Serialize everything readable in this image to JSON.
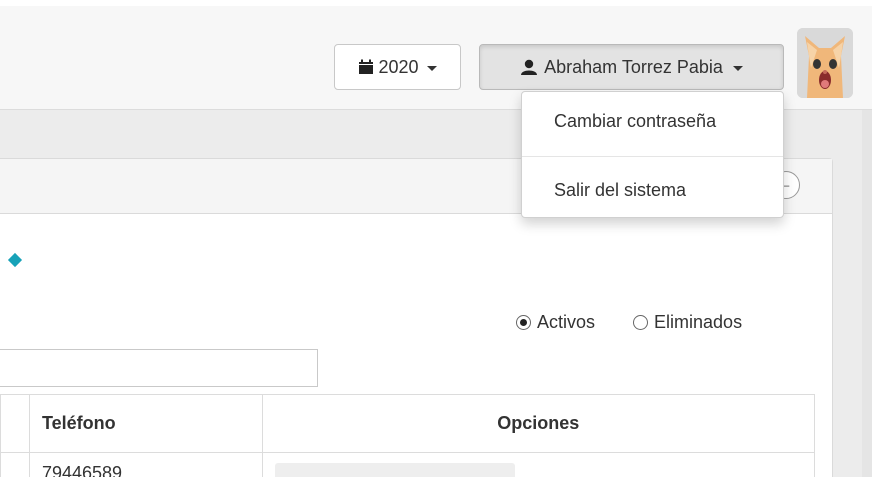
{
  "header": {
    "year_label": "2020",
    "year_icon": "calendar-icon",
    "user_label": "Abraham Torrez Pabia",
    "user_icon": "user-icon"
  },
  "user_menu": {
    "items": [
      {
        "label": "Cambiar contraseña"
      },
      {
        "label": "Salir del sistema"
      }
    ]
  },
  "filters": {
    "radio_active_label": "Activos",
    "radio_deleted_label": "Eliminados",
    "selected": "Activos"
  },
  "search": {
    "value": ""
  },
  "table": {
    "columns": [
      "Teléfono",
      "Opciones"
    ],
    "rows": [
      {
        "telefono": "79446589",
        "opciones": ""
      }
    ]
  },
  "colors": {
    "accent": "#17a2b8"
  }
}
